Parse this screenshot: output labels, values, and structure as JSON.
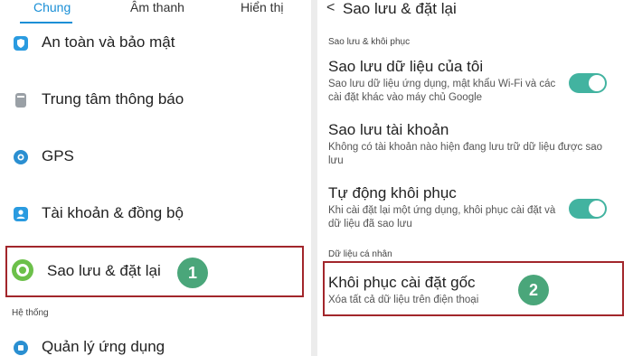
{
  "tabs": [
    {
      "label": "Chung",
      "active": true
    },
    {
      "label": "Âm thanh",
      "active": false
    },
    {
      "label": "Hiển thị",
      "active": false
    }
  ],
  "left_items": [
    {
      "label": "An toàn và bảo mật",
      "icon": "shield-icon"
    },
    {
      "label": "Trung tâm thông báo",
      "icon": "notification-icon"
    },
    {
      "label": "GPS",
      "icon": "location-icon"
    },
    {
      "label": "Tài khoản & đồng bộ",
      "icon": "account-icon"
    },
    {
      "label": "Sao lưu & đặt lại",
      "icon": "backup-icon"
    }
  ],
  "left_section_system": "Hệ thống",
  "left_item_apps": {
    "label": "Quản lý ứng dụng",
    "icon": "apps-icon"
  },
  "step_badges": [
    "1",
    "2"
  ],
  "right": {
    "back_glyph": "<",
    "title": "Sao lưu & đặt lại",
    "section_backup": "Sao lưu & khôi phục",
    "settings": [
      {
        "title": "Sao lưu dữ liệu của tôi",
        "desc": "Sao lưu dữ liệu ứng dụng, mật khẩu Wi-Fi và các cài đặt khác vào máy chủ Google",
        "toggle_on": true
      },
      {
        "title": "Sao lưu tài khoản",
        "desc": "Không có tài khoản nào hiện đang lưu trữ dữ liệu được sao lưu"
      },
      {
        "title": "Tự động khôi phục",
        "desc": "Khi cài đặt lại một ứng dụng, khôi phục cài đặt và dữ liệu đã sao lưu",
        "toggle_on": true
      }
    ],
    "section_personal": "Dữ liệu cá nhân",
    "factory_reset": {
      "title": "Khôi phục cài đặt gốc",
      "desc": "Xóa tất cả dữ liệu trên điện thoại"
    }
  },
  "colors": {
    "accent": "#1a8fd6",
    "highlight": "#a2262b",
    "badge": "#4aa67a",
    "toggle": "#42b3a0",
    "backup_icon": "#6cc04a"
  }
}
